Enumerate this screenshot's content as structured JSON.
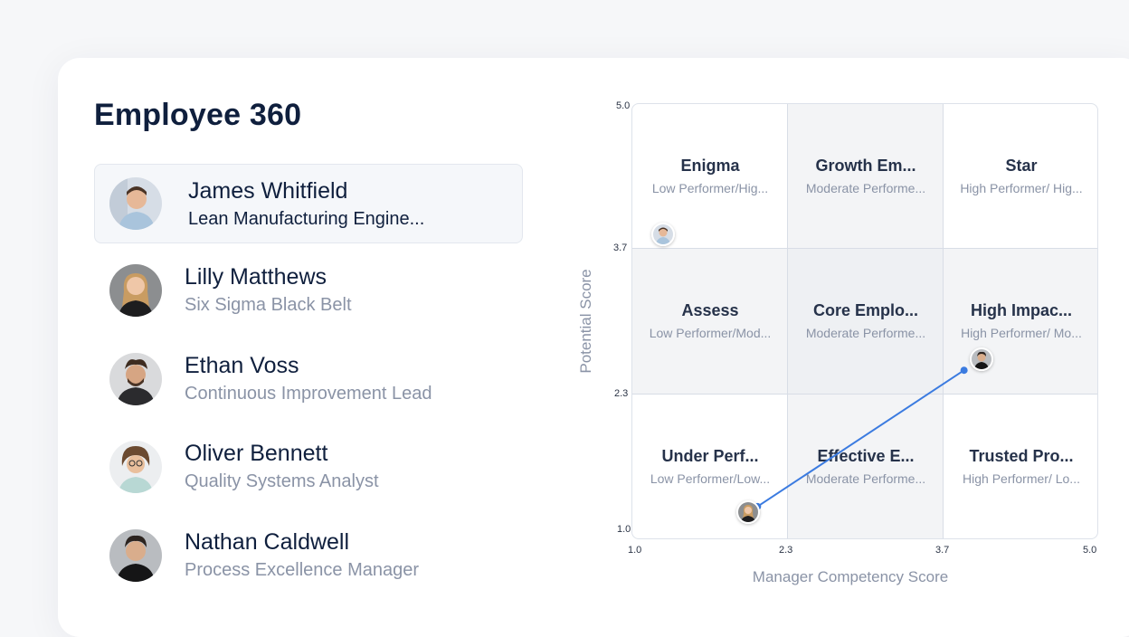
{
  "page": {
    "title": "Employee 360"
  },
  "employees": [
    {
      "name": "James Whitfield",
      "role": "Lean Manufacturing Engine...",
      "selected": true
    },
    {
      "name": "Lilly Matthews",
      "role": "Six Sigma Black Belt"
    },
    {
      "name": "Ethan Voss",
      "role": "Continuous Improvement Lead"
    },
    {
      "name": "Oliver Bennett",
      "role": "Quality Systems Analyst"
    },
    {
      "name": "Nathan Caldwell",
      "role": "Process Excellence Manager"
    }
  ],
  "chart_data": {
    "type": "scatter",
    "xlabel": "Manager Competency Score",
    "ylabel": "Potential  Score",
    "xlim": [
      1.0,
      5.0
    ],
    "ylim": [
      1.0,
      5.0
    ],
    "x_ticks": [
      "1.0",
      "2.3",
      "3.7",
      "5.0"
    ],
    "y_ticks": [
      "5.0",
      "3.7",
      "2.3",
      "1.0"
    ],
    "quadrants": [
      {
        "title": "Enigma",
        "subtitle": "Low Performer/Hig..."
      },
      {
        "title": "Growth Em...",
        "subtitle": "Moderate Performe..."
      },
      {
        "title": "Star",
        "subtitle": "High Performer/ Hig..."
      },
      {
        "title": "Assess",
        "subtitle": "Low Performer/Mod..."
      },
      {
        "title": "Core Emplo...",
        "subtitle": "Moderate Performe..."
      },
      {
        "title": "High Impac...",
        "subtitle": "High Performer/ Mo..."
      },
      {
        "title": "Under Perf...",
        "subtitle": "Low Performer/Low..."
      },
      {
        "title": "Effective E...",
        "subtitle": "Moderate Performe..."
      },
      {
        "title": "Trusted Pro...",
        "subtitle": "High Performer/ Lo..."
      }
    ],
    "points": [
      {
        "employee": "James Whitfield",
        "x": 1.27,
        "y": 3.8
      },
      {
        "employee": "Lilly Matthews",
        "x": 2.0,
        "y": 1.25
      },
      {
        "employee": "Nathan Caldwell",
        "x": 4.0,
        "y": 2.65
      }
    ],
    "trend": {
      "from": [
        2.08,
        1.3
      ],
      "to": [
        3.85,
        2.55
      ],
      "color": "#3b7be0"
    },
    "highlight_color": "#f3f4f6",
    "grid": true
  }
}
